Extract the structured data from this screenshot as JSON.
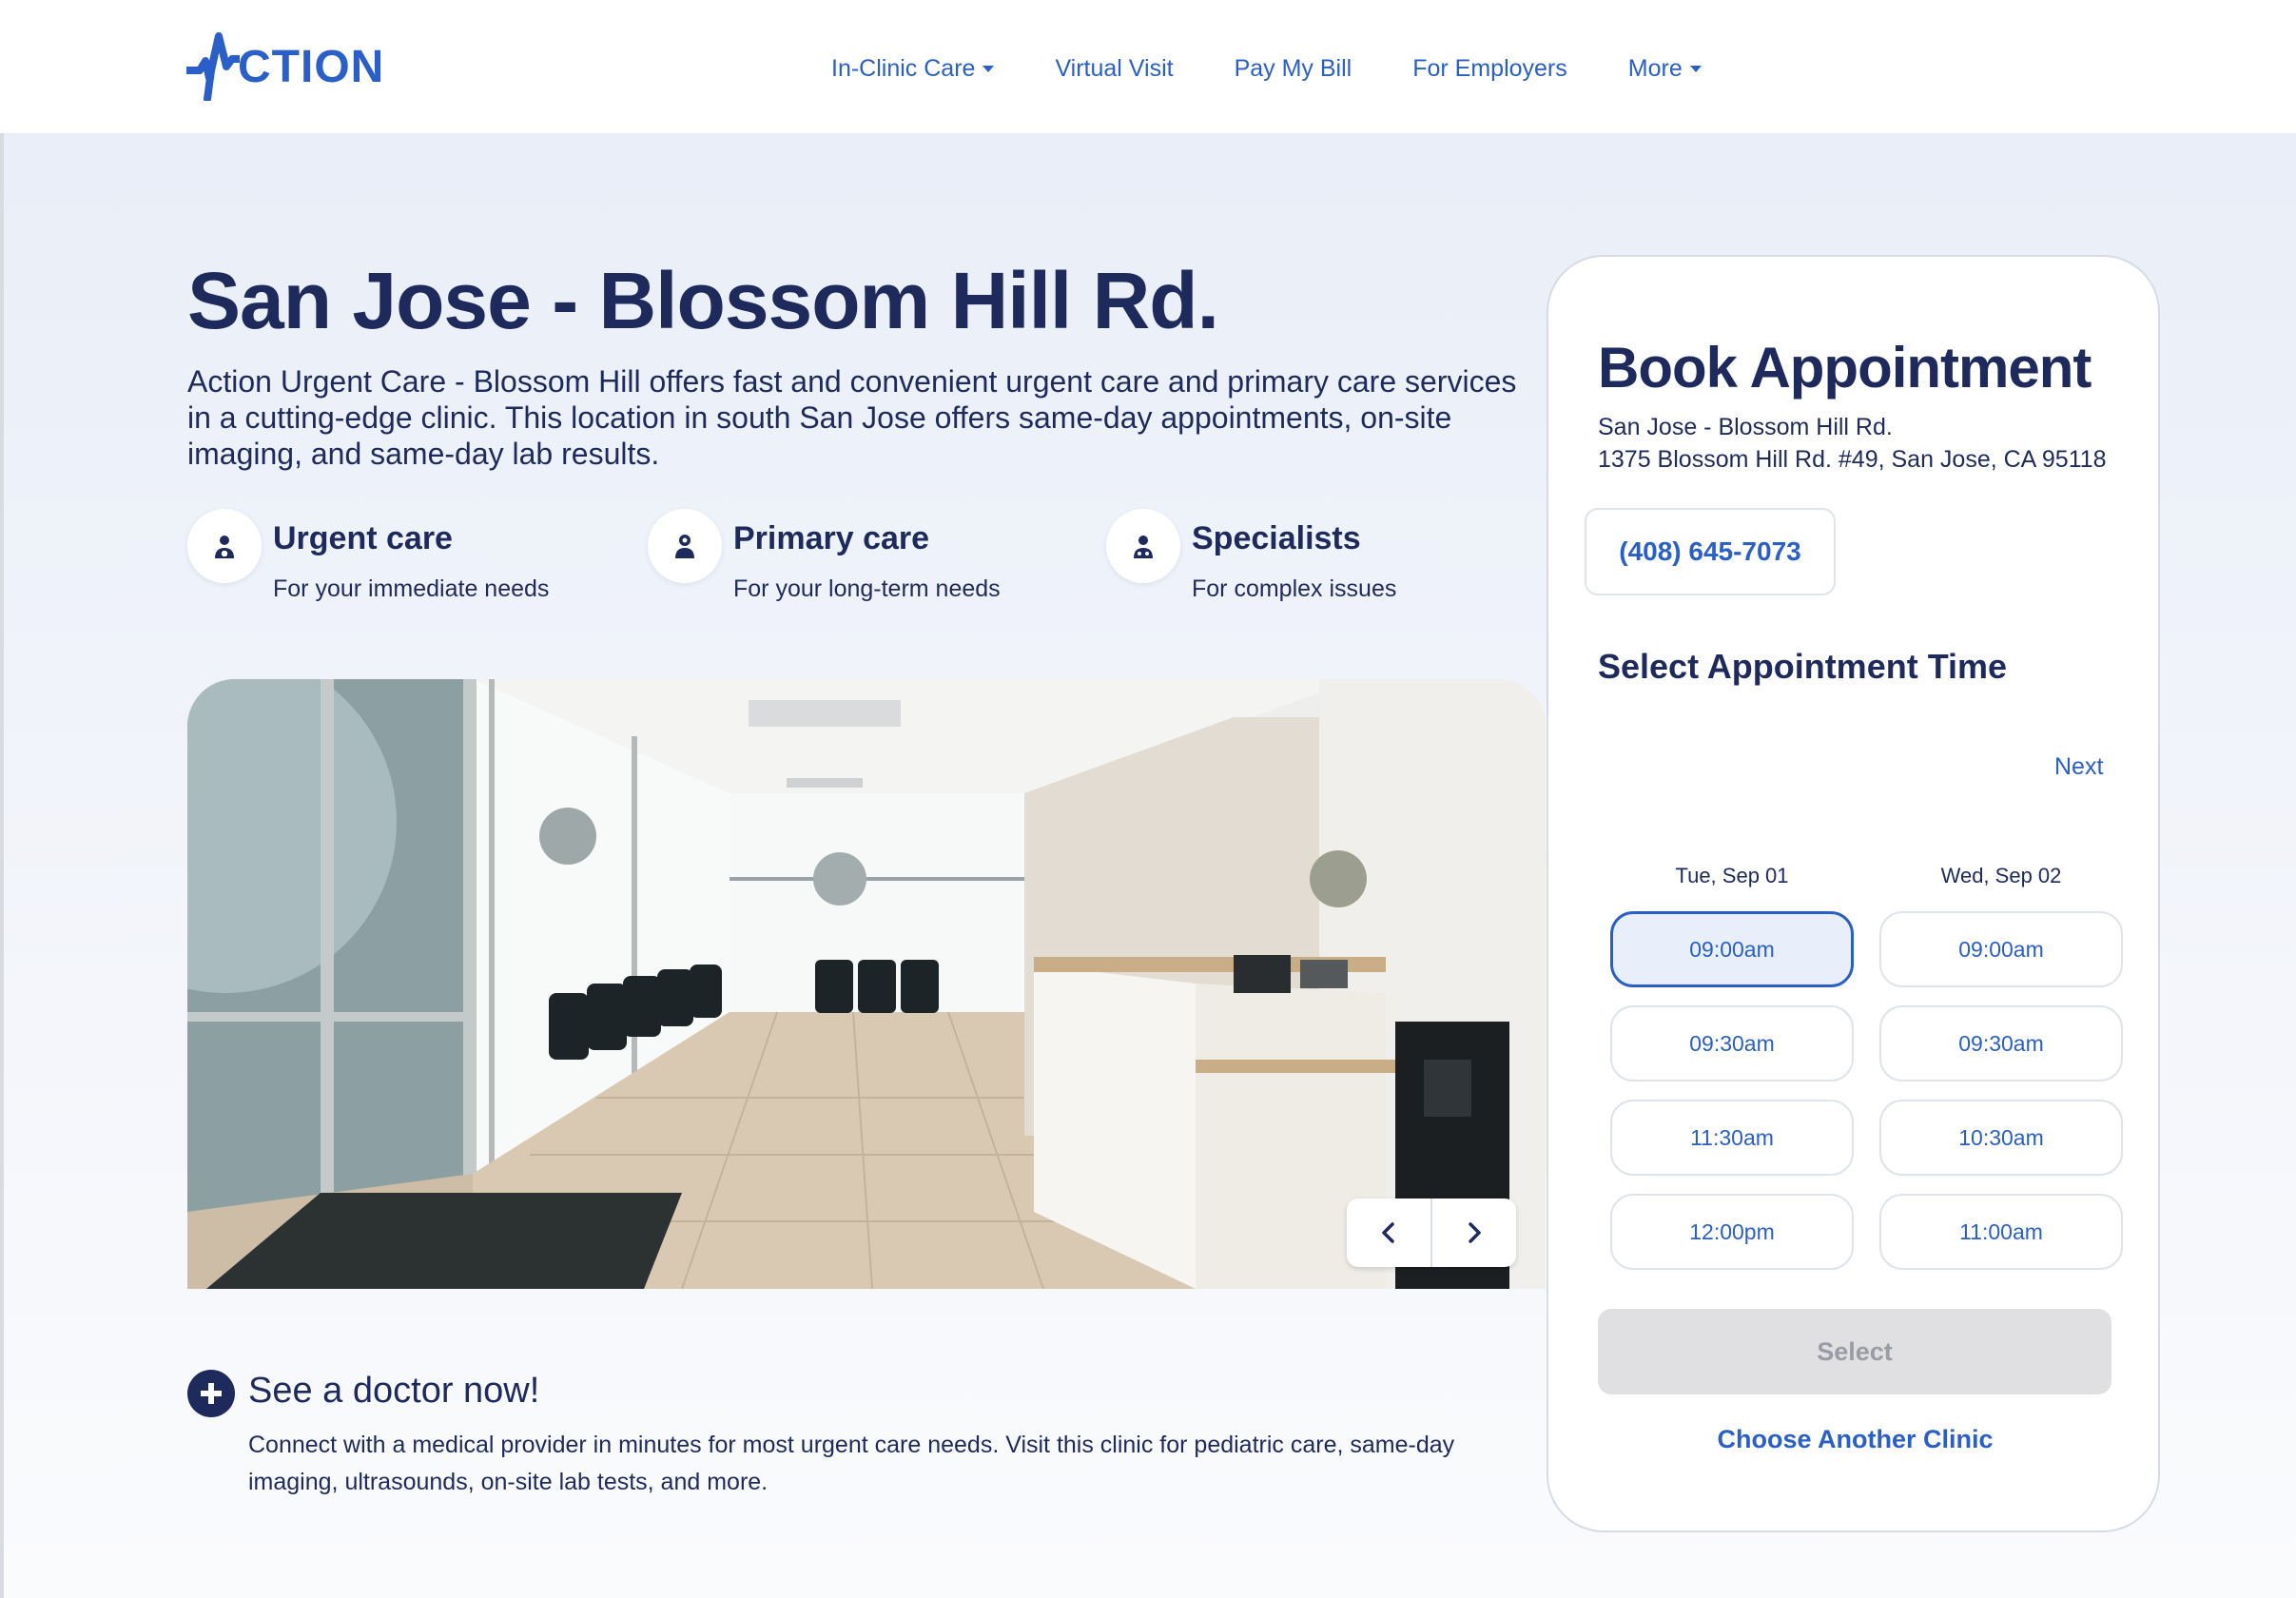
{
  "header": {
    "logo_text": "CTION",
    "nav": [
      {
        "label": "In-Clinic Care",
        "icon": "caret-down-icon"
      },
      {
        "label": "Virtual Visit"
      },
      {
        "label": "Pay My Bill"
      },
      {
        "label": "For Employers"
      },
      {
        "label": "More",
        "icon": "caret-down-icon"
      }
    ]
  },
  "main": {
    "title": "San Jose - Blossom Hill Rd.",
    "intro": "Action Urgent Care - Blossom Hill offers fast and convenient urgent care and primary care services in a cutting-edge clinic. This location in south San Jose offers same-day appointments, on-site imaging, and same-day lab results.",
    "care_types": [
      {
        "title": "Urgent care",
        "subtitle": "For your immediate needs",
        "icon": "urgent-care-icon"
      },
      {
        "title": "Primary care",
        "subtitle": "For your long-term needs",
        "icon": "primary-care-icon"
      },
      {
        "title": "Specialists",
        "subtitle": "For complex issues",
        "icon": "specialist-icon"
      }
    ],
    "see_doctor": {
      "title": "See a doctor now!",
      "text": "Connect with a medical provider in minutes for most urgent care needs. Visit this clinic for pediatric care, same-day imaging, ultrasounds, on-site lab tests, and more."
    }
  },
  "booking": {
    "title": "Book Appointment",
    "location_name": "San Jose - Blossom Hill Rd.",
    "address": "1375 Blossom Hill Rd. #49, San Jose, CA 95118",
    "phone": "(408) 645-7073",
    "select_time_label": "Select Appointment Time",
    "next_label": "Next",
    "days": [
      {
        "label": "Tue, Sep 01",
        "slots": [
          "09:00am",
          "09:30am",
          "11:30am",
          "12:00pm"
        ],
        "selected_index": 0
      },
      {
        "label": "Wed, Sep 02",
        "slots": [
          "09:00am",
          "09:30am",
          "10:30am",
          "11:00am"
        ]
      }
    ],
    "select_button": "Select",
    "another_clinic": "Choose Another Clinic"
  },
  "colors": {
    "brand_blue": "#2a5fc7",
    "navy": "#1f2a5c",
    "page_bg": "#e9eef8"
  }
}
